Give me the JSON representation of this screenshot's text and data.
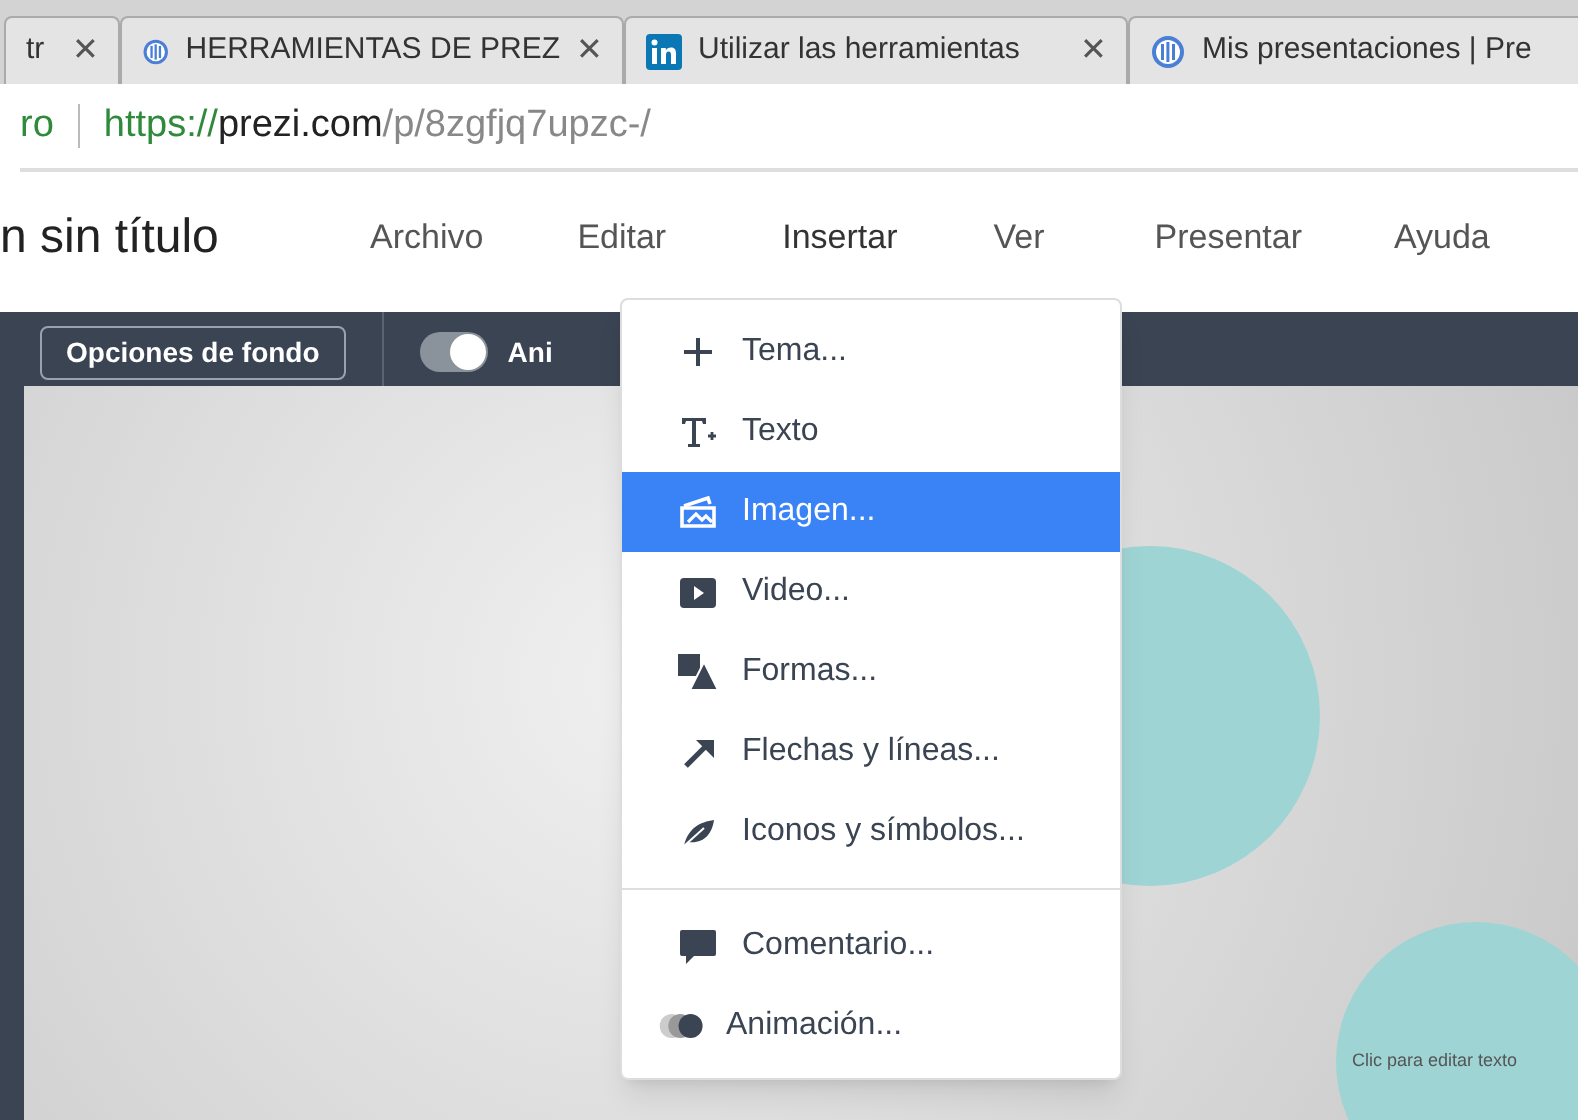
{
  "browser_tabs": [
    {
      "title": "tr",
      "kind": "plain",
      "selected": false
    },
    {
      "title": "HERRAMIENTAS DE PREZ",
      "kind": "prezi",
      "selected": false
    },
    {
      "title": "Utilizar las herramientas",
      "kind": "linkedin",
      "selected": false
    },
    {
      "title": "Mis presentaciones | Pre",
      "kind": "prezi",
      "selected": false
    }
  ],
  "close_glyph": "✕",
  "address_bar": {
    "prefix": "ro",
    "scheme": "https://",
    "host": "prezi.com",
    "path": "/p/8zgfjq7upzc-/"
  },
  "app": {
    "title": "n sin título",
    "menu": [
      {
        "label": "Archivo",
        "selected": false
      },
      {
        "label": "Editar",
        "selected": false
      },
      {
        "label": "Insertar",
        "selected": true
      },
      {
        "label": "Ver",
        "selected": false
      },
      {
        "label": "Presentar",
        "selected": false
      },
      {
        "label": "Ayuda",
        "selected": false
      }
    ]
  },
  "toolbar": {
    "background_button": "Opciones de fondo",
    "animation_toggle": {
      "label": "Ani",
      "on": true
    }
  },
  "insert_menu": {
    "sections": [
      [
        {
          "label": "Tema...",
          "selected": false
        },
        {
          "label": "Texto",
          "selected": false
        },
        {
          "label": "Imagen...",
          "selected": true
        },
        {
          "label": "Video...",
          "selected": false
        },
        {
          "label": "Formas...",
          "selected": false
        },
        {
          "label": "Flechas y líneas...",
          "selected": false
        },
        {
          "label": "Iconos y símbolos...",
          "selected": false
        }
      ],
      [
        {
          "label": "Comentario...",
          "selected": false
        },
        {
          "label": "Animación...",
          "selected": false
        }
      ]
    ]
  },
  "slide": {
    "placeholder_text": "Clic para editar texto"
  }
}
